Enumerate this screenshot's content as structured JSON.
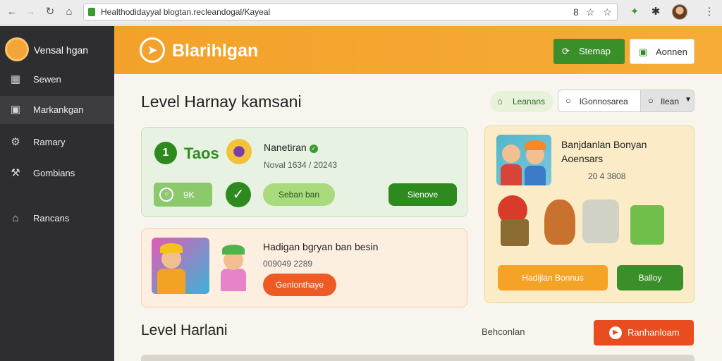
{
  "browser": {
    "url": "Healthodidayyal blogtan.recleandogal/Kayeal",
    "nav": [
      "back",
      "forward",
      "reload",
      "home"
    ]
  },
  "sidebar": {
    "brand": "Vensal hgan",
    "items": [
      {
        "label": "Sewen",
        "icon": "save-icon"
      },
      {
        "label": "Markankgan",
        "icon": "layout-icon"
      },
      {
        "label": "Ramary",
        "icon": "gear-icon"
      },
      {
        "label": "Gombians",
        "icon": "wrench-icon"
      },
      {
        "label": "Rancans",
        "icon": "home-icon"
      }
    ]
  },
  "header": {
    "logo": "Blarihlgan",
    "btn_primary": "Stemap",
    "btn_secondary": "Aonnen"
  },
  "main": {
    "title": "Level Harnay kamsani",
    "chip": "Leanans",
    "search_value": "lGonnosarea",
    "select_value": "Ilean"
  },
  "cards": {
    "c1": {
      "number": "1",
      "badge": "Taos",
      "title": "Nanetiran",
      "meta": "Noval 1634 / 20243",
      "score": "9K",
      "btn_light": "Seban ban",
      "btn_dark": "Sienove"
    },
    "c2": {
      "title": "Hadigan bgryan ban besin",
      "meta": "009049 2289",
      "btn": "Genlonthaye"
    },
    "c3": {
      "title": "Banjdanlan Bonyan",
      "subtitle": "Aoensars",
      "meta": "20 4 3808",
      "btn_orange": "Hadijlan Bonnus",
      "btn_green": "Balloy"
    }
  },
  "section": {
    "title": "Level Harlani",
    "link": "Behconlan",
    "btn": "Ranhanloam"
  },
  "colors": {
    "header_orange": "#f3a12a",
    "sidebar": "#2e2e30",
    "green": "#2e8a1f",
    "orange_red": "#ee5a24"
  }
}
